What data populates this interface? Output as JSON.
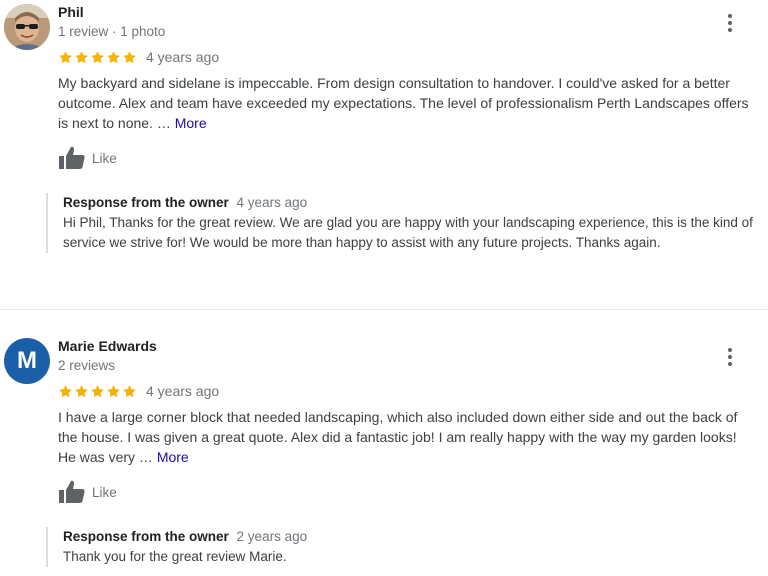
{
  "reviews": [
    {
      "reviewer": "Phil",
      "meta": "1 review · 1 photo",
      "avatar": {
        "kind": "photo",
        "icon": "reviewer-photo"
      },
      "rating": 5,
      "age": "4 years ago",
      "text": "My backyard and sidelane is impeccable. From design consultation to handover. I could've asked for a better outcome. Alex and team have exceeded my expectations. The level of professionalism Perth Landscapes offers is next to none.",
      "ellipsis": " … ",
      "more": "More",
      "like": "Like",
      "response": {
        "title": "Response from the owner",
        "age": "4 years ago",
        "text": "Hi Phil, Thanks for the great review. We are glad you are happy with your landscaping experience, this is the kind of service we strive for! We would be more than happy to assist with any future projects. Thanks again."
      }
    },
    {
      "reviewer": "Marie Edwards",
      "meta": "2 reviews",
      "avatar": {
        "kind": "letter",
        "letter": "M",
        "color": "#1a5fa8"
      },
      "rating": 5,
      "age": "4 years ago",
      "text": "I have a large corner block that needed landscaping, which also included down either side and out the back of the house.  I was  given a great quote. Alex did a fantastic job!  I am really happy with the way my garden looks!  He was very",
      "ellipsis": " … ",
      "more": "More",
      "like": "Like",
      "response": {
        "title": "Response from the owner",
        "age": "2 years ago",
        "text": "Thank you for the great review Marie."
      }
    }
  ],
  "colors": {
    "star": "#f4b400",
    "link": "#1a0dab",
    "muted": "#70757a"
  }
}
